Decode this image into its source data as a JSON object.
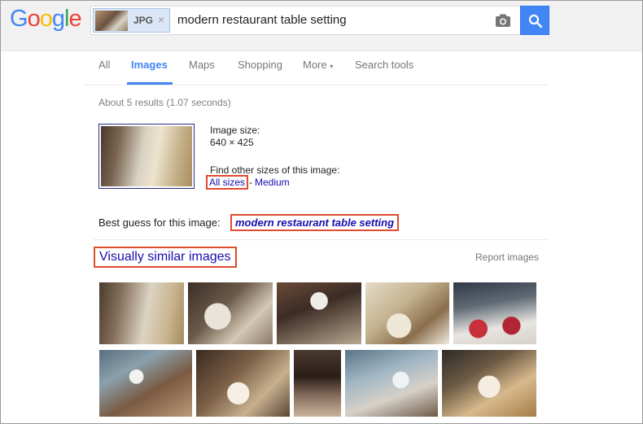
{
  "header": {
    "logo": {
      "letters": [
        "G",
        "o",
        "o",
        "g",
        "l",
        "e"
      ]
    },
    "search": {
      "chip_type": "JPG",
      "chip_close": "×",
      "query": "modern restaurant table setting"
    }
  },
  "tabs": {
    "items": [
      {
        "label": "All",
        "active": false
      },
      {
        "label": "Images",
        "active": true
      },
      {
        "label": "Maps",
        "active": false
      },
      {
        "label": "Shopping",
        "active": false
      },
      {
        "label": "More",
        "active": false
      },
      {
        "label": "Search tools",
        "active": false
      }
    ],
    "more_arrow": "▾"
  },
  "results_stats": "About 5 results (1.07 seconds)",
  "image_info": {
    "size_label": "Image size:",
    "size_value": "640 × 425",
    "find_label": "Find other sizes of this image:",
    "all_sizes": "All sizes",
    "separator": "-",
    "medium": "Medium"
  },
  "best_guess": {
    "label": "Best guess for this image:",
    "value": "modern restaurant table setting"
  },
  "similar": {
    "title": "Visually similar images",
    "report": "Report images"
  },
  "colors": {
    "accent": "#4285f4",
    "link": "#1a0dab",
    "highlight_box": "#e04c2f"
  }
}
